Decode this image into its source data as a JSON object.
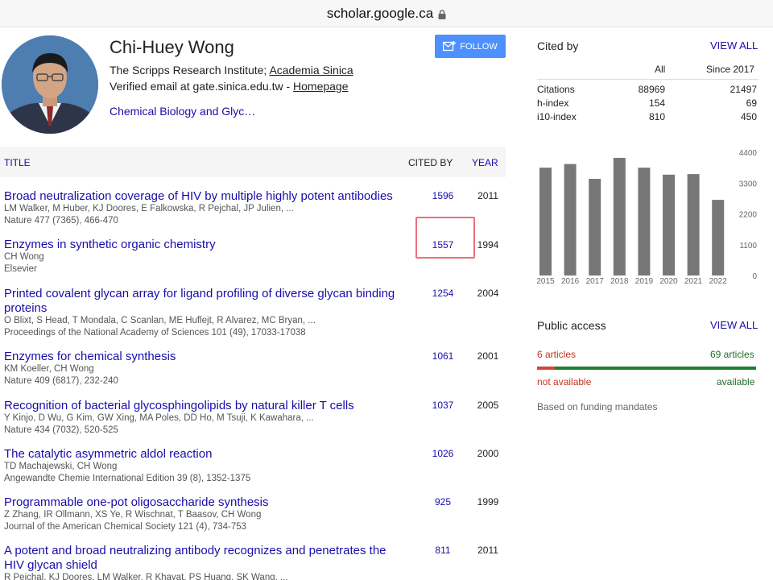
{
  "browser": {
    "url": "scholar.google.ca"
  },
  "profile": {
    "name": "Chi-Huey Wong",
    "affiliation_prefix": "The Scripps Research Institute; ",
    "affiliation_link": "Academia Sinica",
    "email_prefix": "Verified email at gate.sinica.edu.tw - ",
    "homepage_link": "Homepage",
    "interest": "Chemical Biology and Glyc…",
    "follow_label": "FOLLOW"
  },
  "table": {
    "col_title": "TITLE",
    "col_cited": "CITED BY",
    "col_year": "YEAR",
    "rows": [
      {
        "title": "Broad neutralization coverage of HIV by multiple highly potent antibodies",
        "authors": "LM Walker, M Huber, KJ Doores, E Falkowska, R Pejchal, JP Julien, ...",
        "venue": "Nature 477 (7365), 466-470",
        "cites": "1596",
        "year": "2011"
      },
      {
        "title": "Enzymes in synthetic organic chemistry",
        "authors": "CH Wong",
        "venue": "Elsevier",
        "cites": "1557",
        "year": "1994"
      },
      {
        "title": "Printed covalent glycan array for ligand profiling of diverse glycan binding proteins",
        "authors": "O Blixt, S Head, T Mondala, C Scanlan, ME Huflejt, R Alvarez, MC Bryan, ...",
        "venue": "Proceedings of the National Academy of Sciences 101 (49), 17033-17038",
        "cites": "1254",
        "year": "2004"
      },
      {
        "title": "Enzymes for chemical synthesis",
        "authors": "KM Koeller, CH Wong",
        "venue": "Nature 409 (6817), 232-240",
        "cites": "1061",
        "year": "2001"
      },
      {
        "title": "Recognition of bacterial glycosphingolipids by natural killer T cells",
        "authors": "Y Kinjo, D Wu, G Kim, GW Xing, MA Poles, DD Ho, M Tsuji, K Kawahara, ...",
        "venue": "Nature 434 (7032), 520-525",
        "cites": "1037",
        "year": "2005"
      },
      {
        "title": "The catalytic asymmetric aldol reaction",
        "authors": "TD Machajewski, CH Wong",
        "venue": "Angewandte Chemie International Edition 39 (8), 1352-1375",
        "cites": "1026",
        "year": "2000"
      },
      {
        "title": "Programmable one-pot oligosaccharide synthesis",
        "authors": "Z Zhang, IR Ollmann, XS Ye, R Wischnat, T Baasov, CH Wong",
        "venue": "Journal of the American Chemical Society 121 (4), 734-753",
        "cites": "925",
        "year": "1999"
      },
      {
        "title": "A potent and broad neutralizing antibody recognizes and penetrates the HIV glycan shield",
        "authors": "R Pejchal, KJ Doores, LM Walker, R Khayat, PS Huang, SK Wang, ...",
        "venue": "",
        "cites": "811",
        "year": "2011"
      }
    ]
  },
  "cited_by": {
    "title": "Cited by",
    "view_all": "VIEW ALL",
    "col_all": "All",
    "col_since": "Since 2017",
    "metrics": [
      {
        "label": "Citations",
        "all": "88969",
        "since": "21497"
      },
      {
        "label": "h-index",
        "all": "154",
        "since": "69"
      },
      {
        "label": "i10-index",
        "all": "810",
        "since": "450"
      }
    ]
  },
  "chart_data": {
    "type": "bar",
    "categories": [
      "2015",
      "2016",
      "2017",
      "2018",
      "2019",
      "2020",
      "2021",
      "2022"
    ],
    "values": [
      3850,
      3980,
      3450,
      4200,
      3850,
      3600,
      3620,
      2700
    ],
    "yticks": [
      "4400",
      "3300",
      "2200",
      "1100",
      "0"
    ],
    "ylim": [
      0,
      4400
    ],
    "grid": false,
    "bar_color": "#777777"
  },
  "public_access": {
    "title": "Public access",
    "view_all": "VIEW ALL",
    "not_available_count": "6 articles",
    "available_count": "69 articles",
    "not_available_label": "not available",
    "available_label": "available",
    "not_available_fraction": 0.08,
    "note": "Based on funding mandates"
  }
}
